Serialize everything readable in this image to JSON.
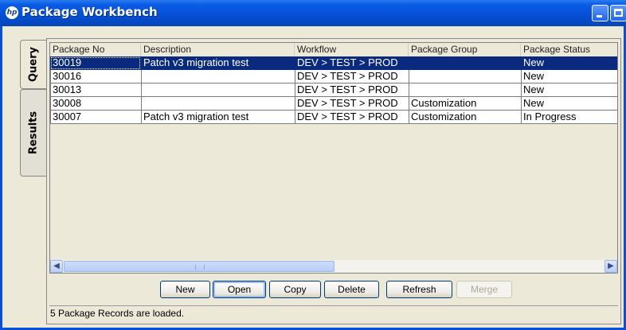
{
  "window": {
    "title": "Package Workbench",
    "app_icon_text": "hp"
  },
  "tabs": [
    {
      "label": "Query"
    },
    {
      "label": "Results"
    }
  ],
  "table": {
    "columns": [
      "Package No",
      "Description",
      "Workflow",
      "Package Group",
      "Package Status"
    ],
    "rows": [
      {
        "package_no": "30019",
        "description": "Patch v3 migration test",
        "workflow": "DEV > TEST > PROD",
        "package_group": "",
        "package_status": "New"
      },
      {
        "package_no": "30016",
        "description": "",
        "workflow": "DEV > TEST > PROD",
        "package_group": "",
        "package_status": "New"
      },
      {
        "package_no": "30013",
        "description": "",
        "workflow": "DEV > TEST > PROD",
        "package_group": "",
        "package_status": "New"
      },
      {
        "package_no": "30008",
        "description": "",
        "workflow": "DEV > TEST > PROD",
        "package_group": "Customization",
        "package_status": "New"
      },
      {
        "package_no": "30007",
        "description": "Patch v3 migration test",
        "workflow": "DEV > TEST > PROD",
        "package_group": "Customization",
        "package_status": "In Progress"
      }
    ],
    "selected_row": 0
  },
  "buttons": {
    "new": "New",
    "open": "Open",
    "copy": "Copy",
    "delete": "Delete",
    "refresh": "Refresh",
    "merge": "Merge"
  },
  "status_text": "5 Package Records are loaded.",
  "colors": {
    "titlebar": "#0550d6",
    "selection": "#0a2a80",
    "face": "#ece9d8"
  }
}
